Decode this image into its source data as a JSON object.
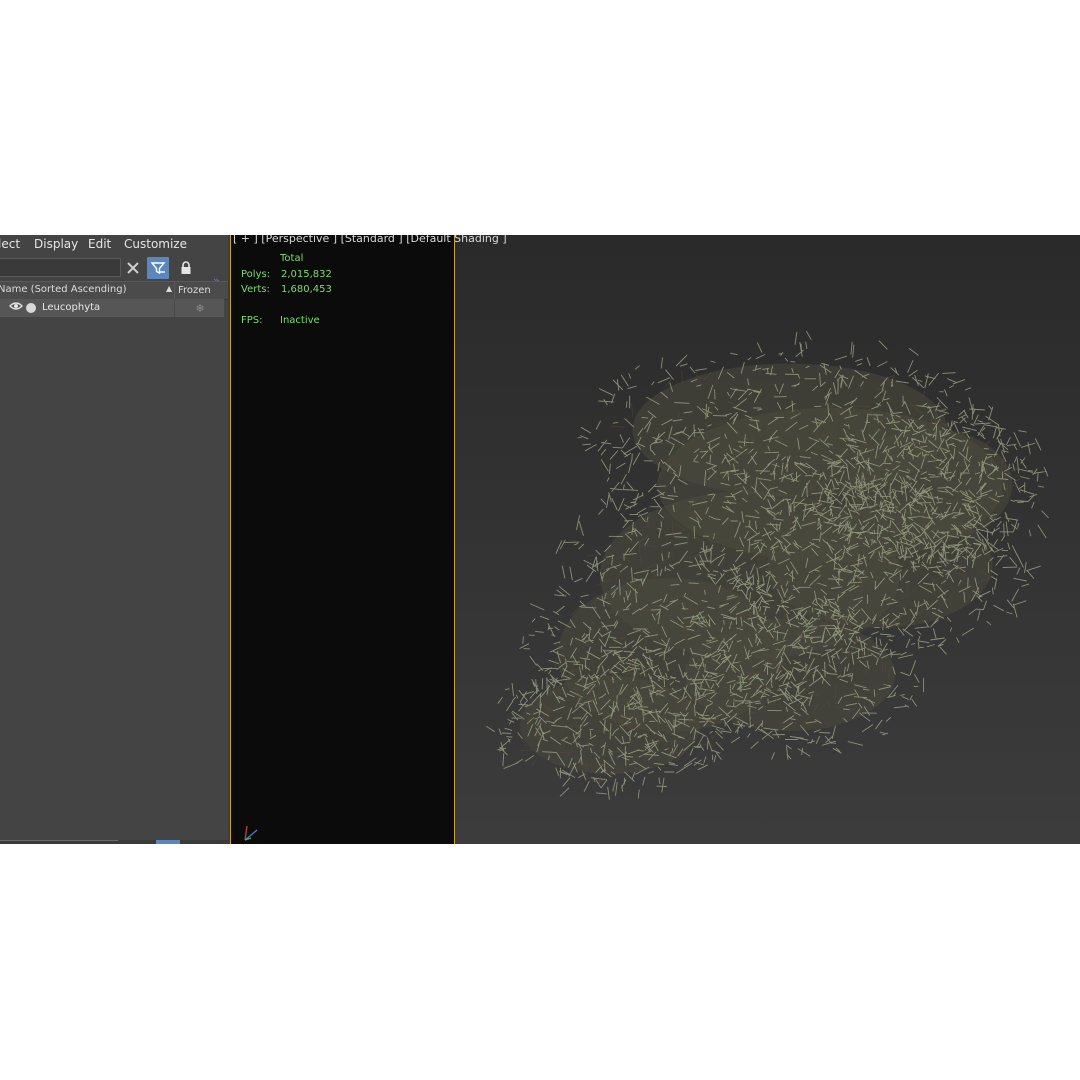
{
  "explorer": {
    "menu": [
      "lect",
      "Display",
      "Edit",
      "Customize"
    ],
    "search": {
      "value": "",
      "placeholder": ""
    },
    "columns": {
      "name": "Name (Sorted Ascending)",
      "frozen": "Frozen"
    },
    "objects": [
      {
        "label": "Leucophyta",
        "visible": true,
        "frozen": false
      }
    ],
    "toolbar_icons": [
      "close-icon",
      "filter-icon",
      "lock-icon"
    ]
  },
  "viewport": {
    "label": "[ + ] [Perspective ] [Standard ] [Default Shading ]",
    "stats": {
      "header": "Total",
      "polys_label": "Polys:",
      "polys_value": "2,015,832",
      "verts_label": "Verts:",
      "verts_value": "1,680,453",
      "fps_label": "FPS:",
      "fps_value": "Inactive"
    },
    "colors": {
      "stats": "#7cdc6c",
      "safe_frame": "#c9a227",
      "foliage": "#8d9478",
      "accent": "#5b87bd"
    }
  }
}
